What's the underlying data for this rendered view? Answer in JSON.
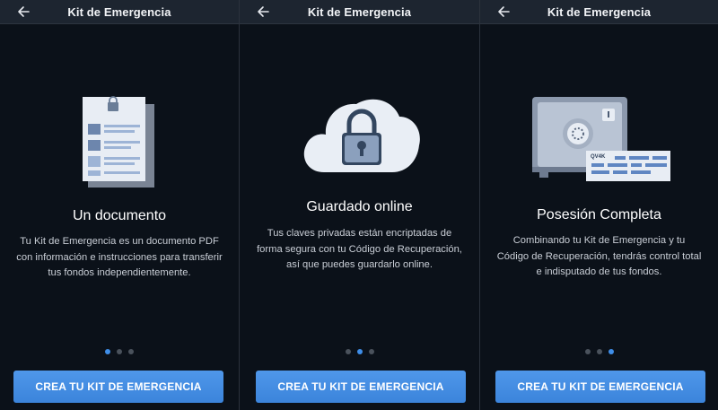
{
  "app": {
    "title": "Kit de Emergencia",
    "accent_color": "#3f8ee8"
  },
  "screens": [
    {
      "title": "Un documento",
      "description": "Tu Kit de Emergencia es un documento PDF con información e instrucciones para transferir tus fondos independientemente.",
      "illustration": "pdf-document-icon",
      "active_dot": 1,
      "cta_label": "CREA TU KIT DE EMERGENCIA"
    },
    {
      "title": "Guardado online",
      "description": "Tus claves privadas están encriptadas de forma segura con tu Código de Recuperación, así que puedes guardarlo online.",
      "illustration": "cloud-lock-icon",
      "active_dot": 2,
      "cta_label": "CREA TU KIT DE EMERGENCIA"
    },
    {
      "title": "Posesión Completa",
      "description": "Combinando tu Kit de Emergencia y tu Código de Recuperación, tendrás control total e indisputado de tus fondos.",
      "illustration": "safe-icon",
      "active_dot": 3,
      "cta_label": "CREA TU KIT DE EMERGENCIA",
      "card_text": "QV4K"
    }
  ],
  "page_indicator": {
    "total": 3
  }
}
